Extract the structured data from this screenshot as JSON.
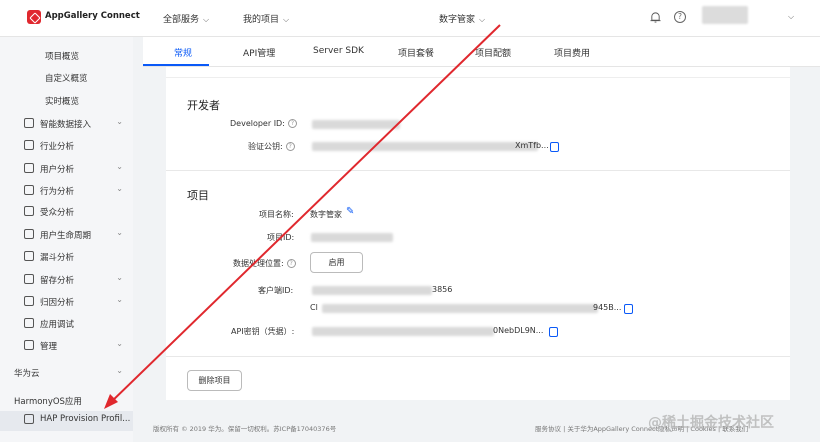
{
  "header": {
    "brand": "AppGallery Connect",
    "nav": [
      {
        "label": "全部服务"
      },
      {
        "label": "我的项目"
      },
      {
        "label": "数字管家"
      }
    ]
  },
  "sidebar": {
    "items": [
      {
        "label": "项目概览",
        "kind": "sub"
      },
      {
        "label": "自定义概览",
        "kind": "sub"
      },
      {
        "label": "实时概览",
        "kind": "sub"
      },
      {
        "label": "智能数据接入",
        "kind": "main",
        "icon": "anchor-icon",
        "arrow": "⌄"
      },
      {
        "label": "行业分析",
        "kind": "main",
        "icon": "building-icon"
      },
      {
        "label": "用户分析",
        "kind": "main",
        "icon": "user-icon",
        "arrow": "⌄"
      },
      {
        "label": "行为分析",
        "kind": "main",
        "icon": "chart-bar-icon",
        "arrow": "⌄"
      },
      {
        "label": "受众分析",
        "kind": "main",
        "icon": "audience-icon"
      },
      {
        "label": "用户生命周期",
        "kind": "main",
        "icon": "users-icon",
        "arrow": "⌄"
      },
      {
        "label": "漏斗分析",
        "kind": "main",
        "icon": "funnel-icon"
      },
      {
        "label": "留存分析",
        "kind": "main",
        "icon": "retention-icon",
        "arrow": "⌄"
      },
      {
        "label": "归因分析",
        "kind": "main",
        "icon": "attribution-icon",
        "arrow": "⌄"
      },
      {
        "label": "应用调试",
        "kind": "main",
        "icon": "debug-icon"
      },
      {
        "label": "管理",
        "kind": "main",
        "icon": "manage-icon",
        "arrow": "⌄"
      },
      {
        "label": "华为云",
        "kind": "section",
        "arrow": "⌄"
      },
      {
        "label": "HarmonyOS应用",
        "kind": "section"
      },
      {
        "label": "HAP Provision Profil...",
        "kind": "main",
        "icon": "profile-icon",
        "active": true
      }
    ]
  },
  "tabs": [
    {
      "label": "常规",
      "active": true
    },
    {
      "label": "API管理"
    },
    {
      "label": "Server SDK"
    },
    {
      "label": "项目套餐"
    },
    {
      "label": "项目配额"
    },
    {
      "label": "项目费用"
    }
  ],
  "developer": {
    "title": "开发者",
    "id_label": "Developer ID:",
    "pubkey_label": "验证公钥:",
    "pubkey_tail": "XmTfb..."
  },
  "project": {
    "title": "项目",
    "name_label": "项目名称:",
    "name_value": "数字管家",
    "id_label": "项目ID:",
    "location_label": "数据处理位置:",
    "location_button": "启用",
    "client_label": "客户端ID:",
    "client_id_tail": "3856",
    "client_prefix": "Cl",
    "client_secret_tail": "945B...",
    "apikey_label": "API密钥（凭据）:",
    "apikey_tail": "0NebDL9N..."
  },
  "delete_button": "删除项目",
  "footer": {
    "left": "版权所有 © 2019 华为。保留一切权利。苏ICP备17040376号",
    "right": "服务协议  |  关于华为AppGallery Connect隐私声明  |  Cookies  |  联系我们"
  },
  "watermark": "@稀土掘金技术社区",
  "colors": {
    "accent": "#0a59f7",
    "arrow": "#e0282e",
    "logo": "#e0282e"
  }
}
